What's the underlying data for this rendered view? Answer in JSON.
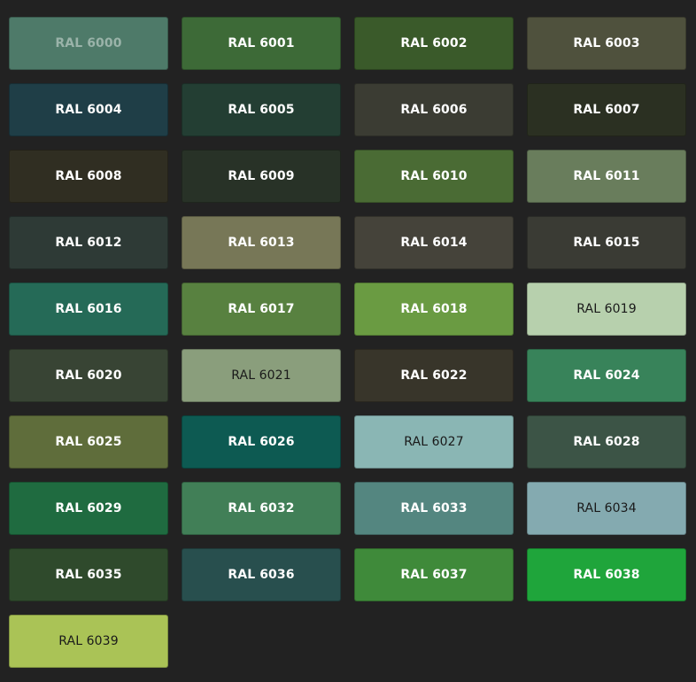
{
  "swatches": [
    {
      "label": "RAL 6000",
      "color": "#4e7a69",
      "text_color": "#9ab3a9",
      "bold": true
    },
    {
      "label": "RAL 6001",
      "color": "#3d6a37",
      "text_color": "#ffffff",
      "bold": true
    },
    {
      "label": "RAL 6002",
      "color": "#3a5a2a",
      "text_color": "#ffffff",
      "bold": true
    },
    {
      "label": "RAL 6003",
      "color": "#4f513d",
      "text_color": "#ffffff",
      "bold": true
    },
    {
      "label": "RAL 6004",
      "color": "#1f3e47",
      "text_color": "#ffffff",
      "bold": true
    },
    {
      "label": "RAL 6005",
      "color": "#233e33",
      "text_color": "#ffffff",
      "bold": true
    },
    {
      "label": "RAL 6006",
      "color": "#3b3c33",
      "text_color": "#ffffff",
      "bold": true
    },
    {
      "label": "RAL 6007",
      "color": "#2b3022",
      "text_color": "#ffffff",
      "bold": true
    },
    {
      "label": "RAL 6008",
      "color": "#302e22",
      "text_color": "#ffffff",
      "bold": true
    },
    {
      "label": "RAL 6009",
      "color": "#283227",
      "text_color": "#ffffff",
      "bold": true
    },
    {
      "label": "RAL 6010",
      "color": "#4a6b34",
      "text_color": "#ffffff",
      "bold": true
    },
    {
      "label": "RAL 6011",
      "color": "#697d5c",
      "text_color": "#ffffff",
      "bold": true
    },
    {
      "label": "RAL 6012",
      "color": "#2e3a36",
      "text_color": "#ffffff",
      "bold": true
    },
    {
      "label": "RAL 6013",
      "color": "#777757",
      "text_color": "#ffffff",
      "bold": true
    },
    {
      "label": "RAL 6014",
      "color": "#45433a",
      "text_color": "#ffffff",
      "bold": true
    },
    {
      "label": "RAL 6015",
      "color": "#3a3b34",
      "text_color": "#ffffff",
      "bold": true
    },
    {
      "label": "RAL 6016",
      "color": "#256a57",
      "text_color": "#ffffff",
      "bold": true
    },
    {
      "label": "RAL 6017",
      "color": "#588140",
      "text_color": "#ffffff",
      "bold": true
    },
    {
      "label": "RAL 6018",
      "color": "#6a9b42",
      "text_color": "#ffffff",
      "bold": true
    },
    {
      "label": "RAL 6019",
      "color": "#b7d0ad",
      "text_color": "#1a1a1a",
      "bold": false
    },
    {
      "label": "RAL 6020",
      "color": "#384434",
      "text_color": "#ffffff",
      "bold": true
    },
    {
      "label": "RAL 6021",
      "color": "#8a9e7c",
      "text_color": "#1a1a1a",
      "bold": false
    },
    {
      "label": "RAL 6022",
      "color": "#38352a",
      "text_color": "#ffffff",
      "bold": true
    },
    {
      "label": "RAL 6024",
      "color": "#38835a",
      "text_color": "#ffffff",
      "bold": true
    },
    {
      "label": "RAL 6025",
      "color": "#5f6d3b",
      "text_color": "#ffffff",
      "bold": true
    },
    {
      "label": "RAL 6026",
      "color": "#0d5a52",
      "text_color": "#ffffff",
      "bold": true
    },
    {
      "label": "RAL 6027",
      "color": "#8ab6b4",
      "text_color": "#1a1a1a",
      "bold": false
    },
    {
      "label": "RAL 6028",
      "color": "#3c5446",
      "text_color": "#ffffff",
      "bold": true
    },
    {
      "label": "RAL 6029",
      "color": "#1f6b40",
      "text_color": "#ffffff",
      "bold": true
    },
    {
      "label": "RAL 6032",
      "color": "#417f57",
      "text_color": "#ffffff",
      "bold": true
    },
    {
      "label": "RAL 6033",
      "color": "#548680",
      "text_color": "#ffffff",
      "bold": true
    },
    {
      "label": "RAL 6034",
      "color": "#84aab0",
      "text_color": "#1a1a1a",
      "bold": false
    },
    {
      "label": "RAL 6035",
      "color": "#2f4a2c",
      "text_color": "#ffffff",
      "bold": true
    },
    {
      "label": "RAL 6036",
      "color": "#284f4e",
      "text_color": "#ffffff",
      "bold": true
    },
    {
      "label": "RAL 6037",
      "color": "#3f8a3a",
      "text_color": "#ffffff",
      "bold": true
    },
    {
      "label": "RAL 6038",
      "color": "#1fa53b",
      "text_color": "#ffffff",
      "bold": true
    },
    {
      "label": "RAL 6039",
      "color": "#aac356",
      "text_color": "#1a1a1a",
      "bold": false
    }
  ]
}
